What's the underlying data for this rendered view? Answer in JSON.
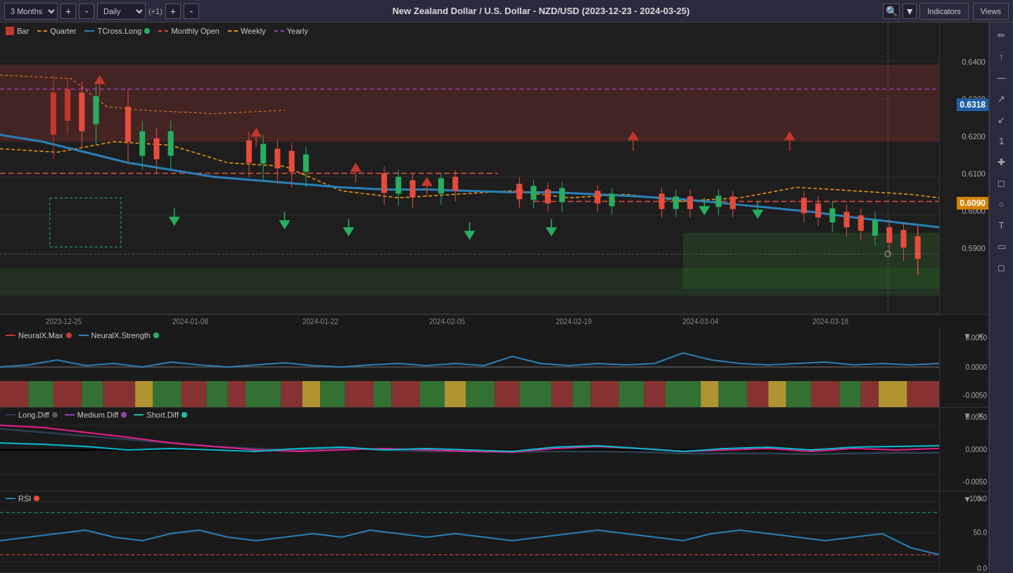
{
  "toolbar": {
    "period": "3 Months",
    "plus_label": "+",
    "minus_label": "-",
    "timeframe": "Daily",
    "step_label": "(+1)",
    "step_plus": "+",
    "step_minus": "-",
    "title": "New Zealand Dollar / U.S. Dollar - NZD/USD (2023-12-23 - 2024-03-25)",
    "indicators_label": "Indicators",
    "views_label": "Views"
  },
  "legend": {
    "bar_label": "Bar",
    "quarter_label": "Quarter",
    "tcross_label": "TCross.Long",
    "monthly_label": "Monthly Open",
    "weekly_label": "Weekly",
    "yearly_label": "Yearly"
  },
  "price_scale": {
    "p6400": "0.6400",
    "p6300": "0.6300",
    "p6200": "0.6200",
    "p6100": "0.6100",
    "p6000": "0.6000",
    "p5900": "0.5900",
    "current_price": "0.6318",
    "orange_price": "0.6090"
  },
  "x_axis": {
    "dates": [
      "2023-12-25",
      "2024-01-08",
      "2024-01-22",
      "2024-02-05",
      "2024-02-19",
      "2024-03-04",
      "2024-03-18"
    ]
  },
  "neurx_panel": {
    "max_label": "NeuralX.Max",
    "strength_label": "NeuralX.Strength",
    "scale_p0050": "0.0050",
    "scale_0": "0.0000",
    "scale_n0050": "-0.0050"
  },
  "diff_panel": {
    "long_label": "Long.Diff",
    "medium_label": "Medium.Diff",
    "short_label": "Short.Diff",
    "scale_p0050": "0.0050",
    "scale_0": "0.0000",
    "scale_n0050": "-0.0050"
  },
  "rsi_panel": {
    "rsi_label": "RSI",
    "scale_100": "100.0",
    "scale_50": "50.0",
    "scale_0": "0.0"
  },
  "right_toolbar": {
    "buttons": [
      "✏️",
      "⬆",
      "—",
      "↗",
      "↙",
      "1",
      "✚",
      "◻",
      "○",
      "T",
      "◻",
      "◻"
    ]
  }
}
